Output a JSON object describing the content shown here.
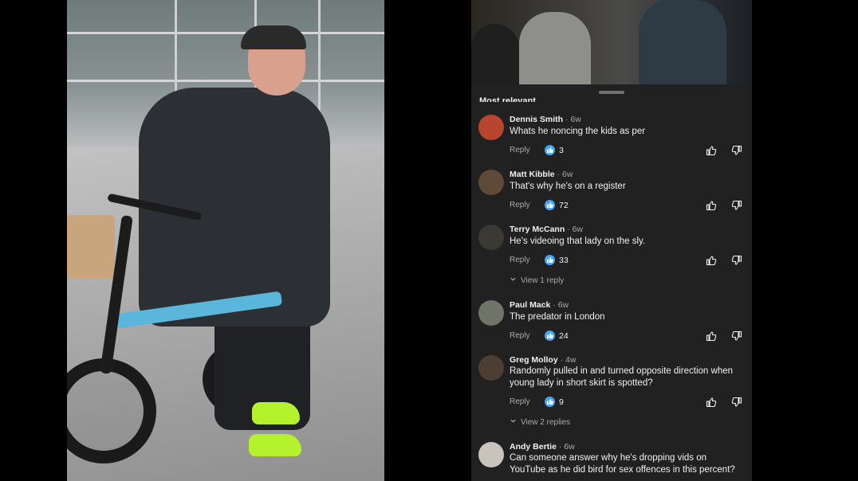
{
  "panel": {
    "sort_label": "Most relevant"
  },
  "comments": [
    {
      "author": "Dennis Smith",
      "age": "· 6w",
      "text": "Whats he noncing the kids as per",
      "reply": "Reply",
      "likes": "3",
      "avatar_color": "#b8452e"
    },
    {
      "author": "Matt Kibble",
      "age": "· 6w",
      "text": "That's why he's on a register",
      "reply": "Reply",
      "likes": "72",
      "avatar_color": "#5e4a36"
    },
    {
      "author": "Terry McCann",
      "age": "· 6w",
      "text": "He's videoing that lady on the sly.",
      "reply": "Reply",
      "likes": "33",
      "avatar_color": "#3a3a32",
      "view_replies": "View 1 reply"
    },
    {
      "author": "Paul Mack",
      "age": "· 6w",
      "text": "The predator in London",
      "reply": "Reply",
      "likes": "24",
      "avatar_color": "#6f7468"
    },
    {
      "author": "Greg Molloy",
      "age": "· 4w",
      "text": "Randomly pulled in and turned opposite direction when young lady in short skirt is spotted?",
      "reply": "Reply",
      "likes": "9",
      "avatar_color": "#4d3e34",
      "view_replies": "View 2 replies"
    },
    {
      "author": "Andy Bertie",
      "age": "· 6w",
      "text": "Can someone answer why he's dropping vids on YouTube as he did bird for sex offences in this percent?",
      "avatar_color": "#c9c4bb"
    }
  ],
  "colors": {
    "accent": "#3ea6ff",
    "panel_bg": "#212121",
    "secondary_text": "#aaaaaa"
  }
}
